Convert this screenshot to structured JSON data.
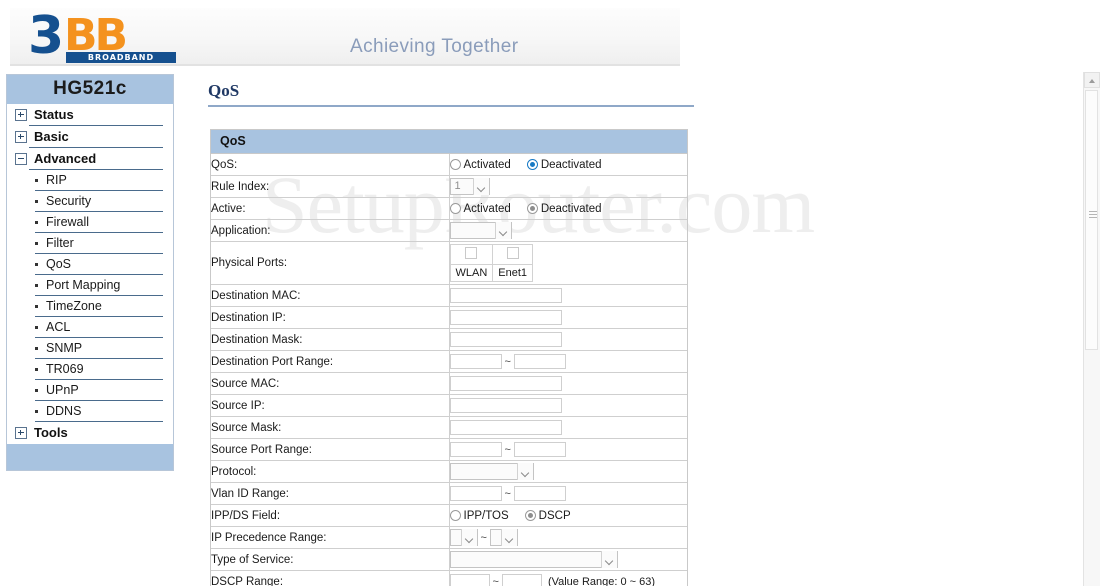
{
  "banner": {
    "logo_three": "3",
    "logo_bb": "BB",
    "logo_sub": "BROADBAND",
    "tagline": "Achieving Together"
  },
  "sidebar": {
    "title": "HG521c",
    "items": [
      {
        "label": "Status",
        "type": "top",
        "state": "collapsed"
      },
      {
        "label": "Basic",
        "type": "top",
        "state": "collapsed"
      },
      {
        "label": "Advanced",
        "type": "top",
        "state": "expanded"
      },
      {
        "label": "RIP",
        "type": "sub"
      },
      {
        "label": "Security",
        "type": "sub"
      },
      {
        "label": "Firewall",
        "type": "sub"
      },
      {
        "label": "Filter",
        "type": "sub"
      },
      {
        "label": "QoS",
        "type": "sub"
      },
      {
        "label": "Port Mapping",
        "type": "sub"
      },
      {
        "label": "TimeZone",
        "type": "sub"
      },
      {
        "label": "ACL",
        "type": "sub"
      },
      {
        "label": "SNMP",
        "type": "sub"
      },
      {
        "label": "TR069",
        "type": "sub"
      },
      {
        "label": "UPnP",
        "type": "sub"
      },
      {
        "label": "DDNS",
        "type": "sub"
      },
      {
        "label": "Tools",
        "type": "top",
        "state": "collapsed"
      }
    ]
  },
  "main": {
    "page_title": "QoS",
    "watermark": "SetupRouter.com",
    "section_header": "QoS",
    "rows": {
      "qos": {
        "label": "QoS:",
        "option_activated": "Activated",
        "option_deactivated": "Deactivated",
        "selected": "Deactivated"
      },
      "rule_index": {
        "label": "Rule Index:",
        "value": "1"
      },
      "active": {
        "label": "Active:",
        "option_activated": "Activated",
        "option_deactivated": "Deactivated",
        "selected": "Deactivated"
      },
      "application": {
        "label": "Application:",
        "value": ""
      },
      "physical_ports": {
        "label": "Physical Ports:",
        "ports": [
          {
            "name": "WLAN",
            "checked": false
          },
          {
            "name": "Enet1",
            "checked": false
          }
        ]
      },
      "destination_mac": {
        "label": "Destination MAC:",
        "value": ""
      },
      "destination_ip": {
        "label": "Destination IP:",
        "value": ""
      },
      "destination_mask": {
        "label": "Destination Mask:",
        "value": ""
      },
      "destination_port_range": {
        "label": "Destination Port Range:",
        "from": "",
        "to": "",
        "separator": "~"
      },
      "source_mac": {
        "label": "Source MAC:",
        "value": ""
      },
      "source_ip": {
        "label": "Source IP:",
        "value": ""
      },
      "source_mask": {
        "label": "Source Mask:",
        "value": ""
      },
      "source_port_range": {
        "label": "Source Port Range:",
        "from": "",
        "to": "",
        "separator": "~"
      },
      "protocol": {
        "label": "Protocol:",
        "value": ""
      },
      "vlan_id_range": {
        "label": "Vlan ID Range:",
        "from": "",
        "to": "",
        "separator": "~"
      },
      "ipp_ds_field": {
        "label": "IPP/DS Field:",
        "option_ipp_tos": "IPP/TOS",
        "option_dscp": "DSCP",
        "selected": "DSCP"
      },
      "ip_precedence_range": {
        "label": "IP Precedence Range:",
        "from": "",
        "to": "",
        "separator": "~"
      },
      "type_of_service": {
        "label": "Type of Service:",
        "value": ""
      },
      "dscp_range": {
        "label": "DSCP Range:",
        "from": "",
        "to": "",
        "separator": "~",
        "hint": "(Value Range: 0 ~ 63)"
      }
    }
  },
  "colors": {
    "accent_blue": "#a8c3e0",
    "logo_blue": "#15508f",
    "logo_orange": "#f4921e",
    "title_navy": "#1f3864",
    "radio_on": "#1779c4"
  }
}
